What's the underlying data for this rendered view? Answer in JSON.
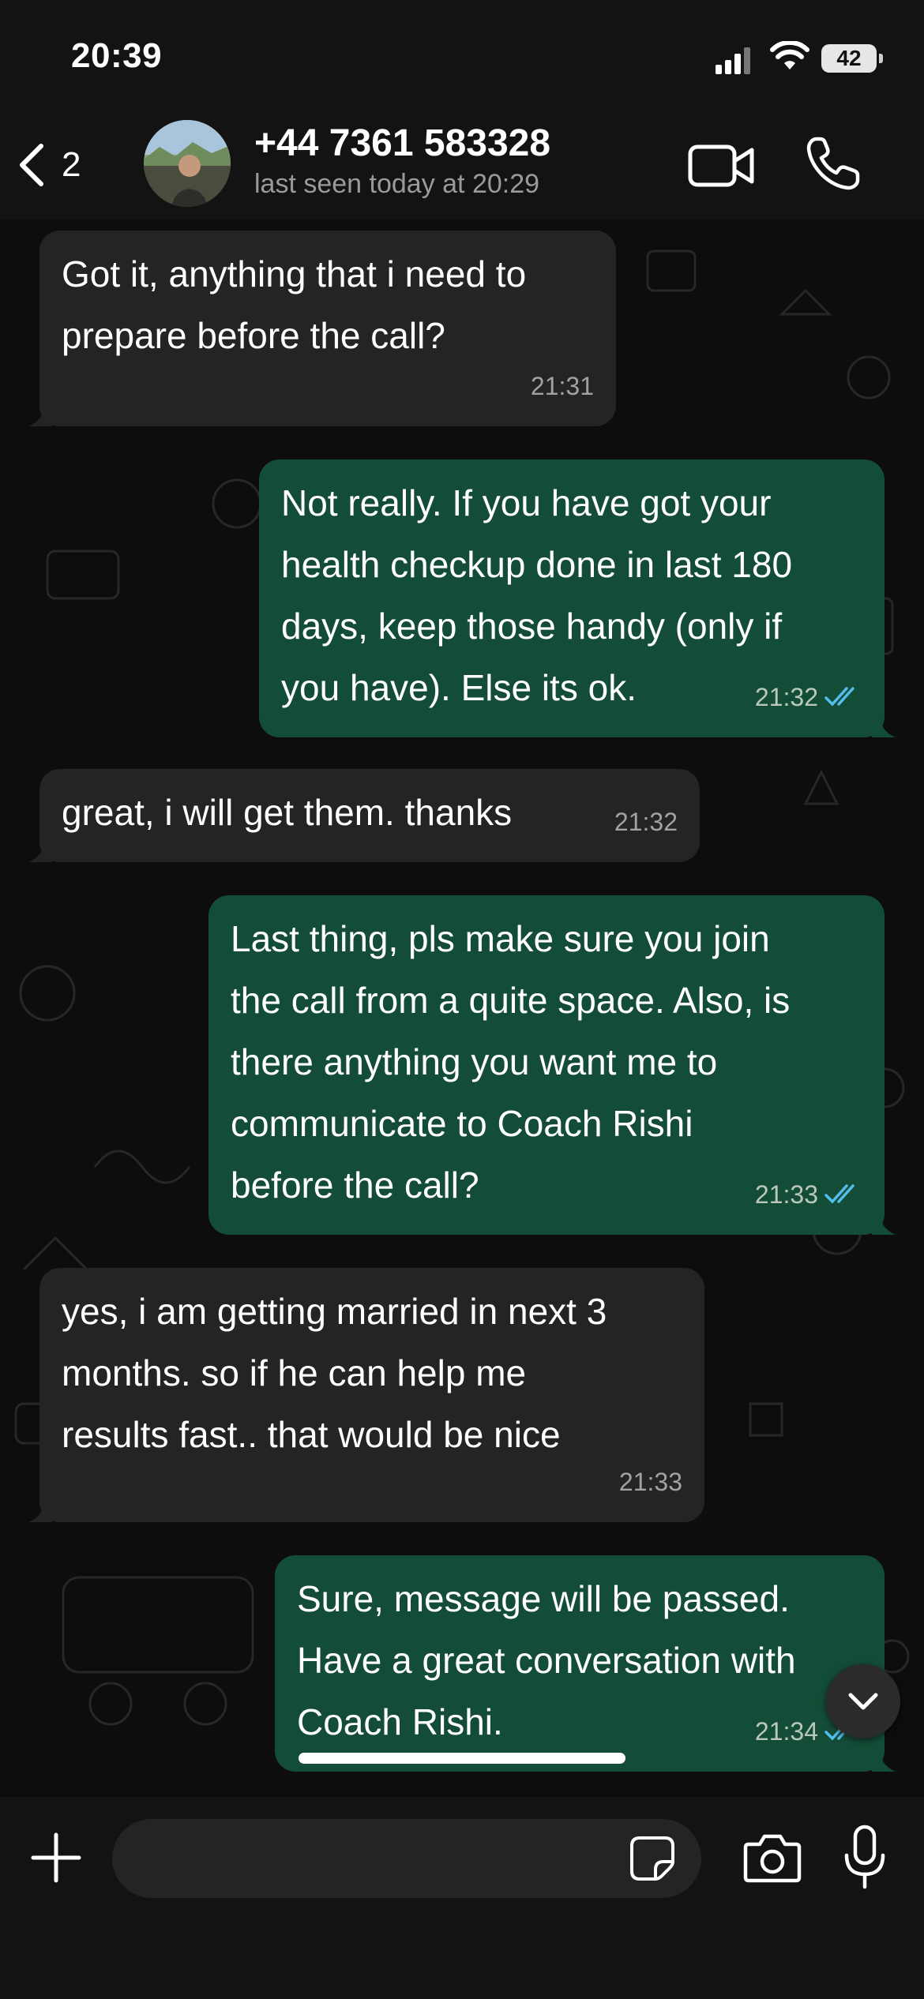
{
  "status_bar": {
    "time": "20:39",
    "battery": "42"
  },
  "header": {
    "back_count": "2",
    "contact_name": "+44 7361 583328",
    "contact_status": "last seen today at 20:29",
    "icons": [
      "chevron-left-icon",
      "video-call-icon",
      "phone-icon"
    ]
  },
  "messages": [
    {
      "direction": "incoming",
      "text": "Got it, anything that i need to\nprepare before the call?",
      "time": "21:31"
    },
    {
      "direction": "outgoing",
      "text": "Not really. If you have got your\nhealth checkup done in last 180\ndays, keep those handy (only if\nyou have). Else its ok.",
      "time": "21:32",
      "status": "read"
    },
    {
      "direction": "incoming",
      "text": "great, i will get them. thanks",
      "time": "21:32"
    },
    {
      "direction": "outgoing",
      "text": "Last thing, pls make sure you join\nthe call from a quite space. Also, is\nthere anything you want me to\ncommunicate to Coach Rishi\nbefore the call?",
      "time": "21:33",
      "status": "read"
    },
    {
      "direction": "incoming",
      "text": "yes, i am getting married in next 3\nmonths. so if he can help me\nresults fast.. that would be nice",
      "time": "21:33"
    },
    {
      "direction": "outgoing",
      "text": "Sure, message will be passed.\nHave a great conversation with\nCoach Rishi.",
      "time": "21:34",
      "status": "read"
    }
  ],
  "input": {
    "placeholder": "",
    "value": ""
  },
  "colors": {
    "incoming_bubble": "#242424",
    "outgoing_bubble": "#144d37",
    "read_ticks": "#53bdeb",
    "background": "#0b0b0b"
  }
}
